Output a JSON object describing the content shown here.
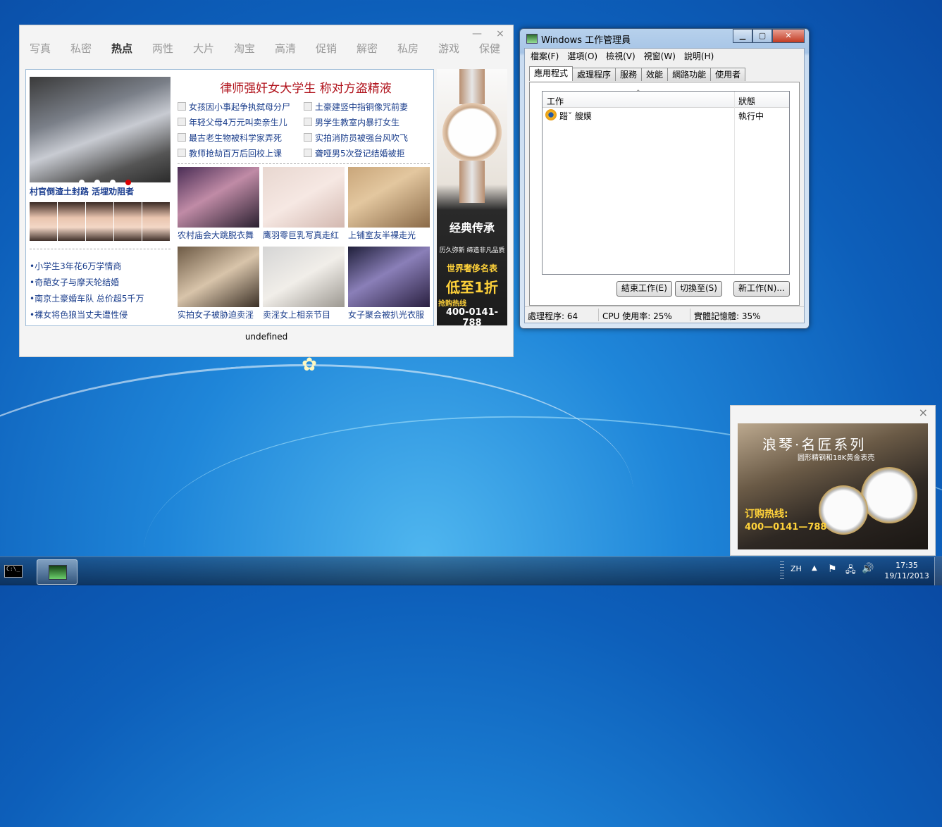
{
  "ad_window": {
    "close_label": "×",
    "min_label": "—",
    "tabs": [
      {
        "label": "写真",
        "active": false
      },
      {
        "label": "私密",
        "active": false
      },
      {
        "label": "热点",
        "active": true
      },
      {
        "label": "两性",
        "active": false
      },
      {
        "label": "大片",
        "active": false
      },
      {
        "label": "淘宝",
        "active": false
      },
      {
        "label": "高清",
        "active": false
      },
      {
        "label": "促销",
        "active": false
      },
      {
        "label": "解密",
        "active": false
      },
      {
        "label": "私房",
        "active": false
      },
      {
        "label": "游戏",
        "active": false
      },
      {
        "label": "保健",
        "active": false
      }
    ],
    "main_caption": "村官倒渣土封路 活埋劝阻者",
    "left_links": [
      "•小学生3年花6万学情商",
      "•奇葩女子与摩天轮结婚",
      "•南京土豪婚车队 总价超5千万",
      "•裸女将色狼当丈夫遭性侵"
    ],
    "headline": "律师强奸女大学生 称对方盗精液",
    "news_left": [
      "女孩因小事起争执弑母分尸",
      "年轻父母4万元叫卖亲生儿",
      "最古老生物被科学家弄死",
      "教师抢劫百万后回校上课"
    ],
    "news_right": [
      "土豪建竖中指铜像咒前妻",
      "男学生教室内暴打女生",
      "实拍消防员被强台风吹飞",
      "聋哑男5次登记结婚被拒"
    ],
    "thumbs": [
      {
        "caption": "农村庙会大跳脱衣舞"
      },
      {
        "caption": "鹰羽零巨乳写真走红"
      },
      {
        "caption": "上铺室友半裸走光"
      },
      {
        "caption": "实拍女子被胁迫卖淫"
      },
      {
        "caption": "卖淫女上相亲节目"
      },
      {
        "caption": "女子聚会被扒光衣服"
      }
    ],
    "side_ad": {
      "brand_line": "经典传承",
      "small_line": "历久弥新 缔造非凡品质",
      "slogan": "世界奢侈名表",
      "price": "低至1折",
      "hotline_label": "抢购热线",
      "phone": "400-0141-788"
    },
    "footer": "undefined"
  },
  "task_manager": {
    "title": "Windows 工作管理員",
    "menu": [
      "檔案(F)",
      "選項(O)",
      "檢視(V)",
      "視窗(W)",
      "說明(H)"
    ],
    "tabs": [
      {
        "label": "應用程式",
        "active": true
      },
      {
        "label": "處理程序",
        "active": false
      },
      {
        "label": "服務",
        "active": false
      },
      {
        "label": "效能",
        "active": false
      },
      {
        "label": "網路功能",
        "active": false
      },
      {
        "label": "使用者",
        "active": false
      }
    ],
    "col_task": "工作",
    "col_status": "狀態",
    "sort_indicator": "^",
    "rows": [
      {
        "name": "踖ˇ 艘嫫",
        "status": "執行中",
        "icon": "app-icon"
      }
    ],
    "buttons": [
      "結束工作(E)",
      "切換至(S)",
      "新工作(N)..."
    ],
    "status_bar": {
      "processes": "處理程序: 64",
      "cpu": "CPU 使用率: 25%",
      "memory": "實體記憶體: 35%"
    }
  },
  "corner_ad": {
    "close_label": "×",
    "title": "浪琴·名匠系列",
    "subtitle": "圆形精钢和18K黄金表壳",
    "hotline": "订购热线:",
    "phone": "400—0141—788"
  },
  "taskbar": {
    "language": "ZH",
    "time": "17:35",
    "date": "19/11/2013",
    "cmd_icon_text": "C:\\_"
  }
}
